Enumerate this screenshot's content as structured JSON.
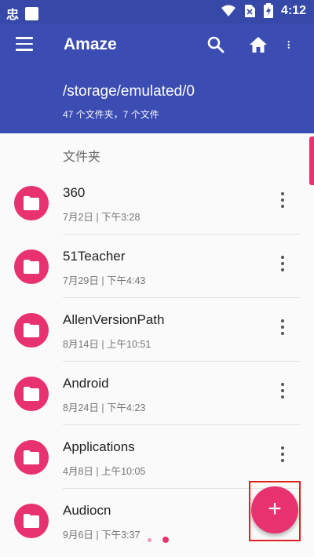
{
  "status_bar": {
    "left_glyph": "忠",
    "time": "4:12"
  },
  "app_bar": {
    "title": "Amaze",
    "icons": [
      "menu-icon",
      "search-icon",
      "home-icon",
      "more-vert-icon"
    ]
  },
  "path_header": {
    "path": "/storage/emulated/0",
    "count": "47 个文件夹，7 个文件"
  },
  "section": {
    "title": "文件夹"
  },
  "items": [
    {
      "name": "360",
      "date": "7月2日 | 下午3:28"
    },
    {
      "name": "51Teacher",
      "date": "7月29日 | 下午4:43"
    },
    {
      "name": "AllenVersionPath",
      "date": "8月14日 | 上午10:51"
    },
    {
      "name": "Android",
      "date": "8月24日 | 下午4:23"
    },
    {
      "name": "Applications",
      "date": "4月8日 | 上午10:05"
    },
    {
      "name": "Audiocn",
      "date": "9月6日 | 下午3:37"
    }
  ],
  "fab": {
    "label": "+"
  },
  "colors": {
    "primary": "#3b4cb3",
    "accent": "#e8326f",
    "highlight_box": "#e02020"
  }
}
